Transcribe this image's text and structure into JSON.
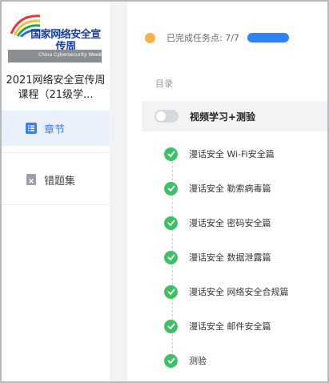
{
  "sidebar": {
    "cover": {
      "title": "国家网络安全宣传周",
      "subtitle": "China Cybersecurity Week"
    },
    "course_name": "2021网络安全宣传周课程（21级学...",
    "nav": [
      {
        "label": "章节",
        "icon": "list-icon",
        "active": true
      },
      {
        "label": "错题集",
        "icon": "error-book-icon",
        "active": false
      }
    ]
  },
  "main": {
    "progress": {
      "label": "已完成任务点: 7/7",
      "completed": 7,
      "total": 7
    },
    "toc_label": "目录",
    "chapter": {
      "title": "视频学习+测验"
    },
    "lessons": [
      {
        "title": "漫话安全 Wi-Fi安全篇",
        "status": "completed"
      },
      {
        "title": "漫话安全 勒索病毒篇",
        "status": "completed"
      },
      {
        "title": "漫话安全 密码安全篇",
        "status": "completed"
      },
      {
        "title": "漫话安全 数据泄露篇",
        "status": "completed"
      },
      {
        "title": "漫话安全 网络安全合规篇",
        "status": "completed"
      },
      {
        "title": "漫话安全 邮件安全篇",
        "status": "completed"
      },
      {
        "title": "测验",
        "status": "completed"
      }
    ]
  },
  "colors": {
    "accent": "#2e84f5",
    "success": "#3dc165",
    "progress_dot": "#f7b24a",
    "active_nav_bg": "#eaf1fc"
  }
}
